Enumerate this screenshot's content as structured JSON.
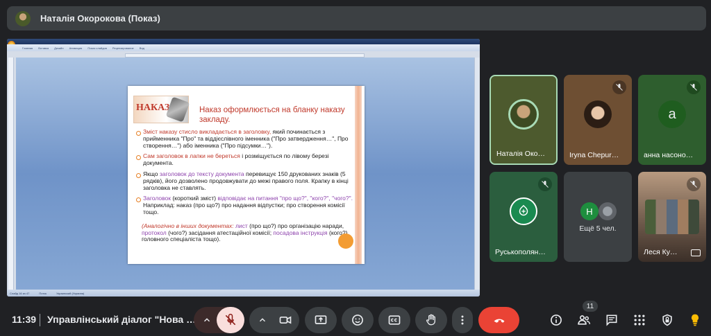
{
  "banner": {
    "presenter_title": "Наталія Окорокова (Показ)"
  },
  "shared_screen": {
    "word_ribbon_tabs": [
      "Главная",
      "Вставка",
      "Дизайн",
      "Анимация",
      "Показ слайдов",
      "Рецензирование",
      "Вид"
    ],
    "word_status_items": [
      "Слайд 16 из 47",
      "Поток",
      "Украинский (Украина)"
    ],
    "slide": {
      "logo_word": "НАКАЗ",
      "heading": "Наказ оформлюється на бланку наказу закладу.",
      "bullets": [
        {
          "red": "Зміст наказу стисло викладається в заголовку,",
          "rest": " який починається з прийменника \"Про\" та віддієслівного іменника (\"Про затвердження…\", Про створення…\") або іменника (\"Про підсумки…\")."
        },
        {
          "red": "Сам заголовок в лапки не береться",
          "rest": " і розміщується по лівому березі документа."
        },
        {
          "before": "Якщо ",
          "purple": "заголовок до тексту документа",
          "rest": " перевищує 150 друкованих знаків (5 рядків), його дозволено продовжувати до межі правого поля. Крапку в кінці заголовка не ставлять."
        },
        {
          "purple": "Заголовок",
          "mid": " (короткий зміст) ",
          "purple2": "відповідає на питання \"про що?\", \"кого?\", \"чого?\".",
          "rest": " Наприклад: наказ (про що?) про надання відпустки; про створення комісії тощо."
        }
      ],
      "italic_red": "(Аналогічно в інших документах:",
      "italic_list": " лист",
      "italic_rest1": " (про що?) про організацію наради, ",
      "italic_protocol": "протокол",
      "italic_rest2": " (чого?) засідання атестаційної комісії; ",
      "italic_instr": "посадова інструкція",
      "italic_rest3": " (кого?) головного спеціаліста тощо)."
    }
  },
  "participants": [
    {
      "name": "Наталія Око…",
      "muted": false,
      "speaking": true
    },
    {
      "name": "Iryna Chepur…",
      "muted": true
    },
    {
      "name": "анна насоно…",
      "muted": true,
      "avatar_letter": "а"
    },
    {
      "name": "Руськополян…",
      "muted": true
    },
    {
      "name": "Ещё 5 чел.",
      "avatar_letter": "Н"
    },
    {
      "name": "Леся Ку…",
      "muted": true
    }
  ],
  "bottom_bar": {
    "time": "11:39",
    "meeting_name": "Управлінський діалог \"Нова …",
    "participants_count": "11"
  },
  "colors": {
    "background": "#202124",
    "surface": "#3c4043",
    "mic_off": "#f9dedc",
    "mic_off_icon": "#8c1d18",
    "end_call": "#ea4335",
    "speaking_border": "#a8dab5"
  },
  "icons": {
    "mic": "mic-off-icon",
    "camera": "videocam-icon",
    "present": "present-screen-icon",
    "reactions": "emoji-icon",
    "captions": "closed-captions-icon",
    "hand": "raise-hand-icon",
    "more": "more-vert-icon",
    "end": "call-end-icon",
    "info": "info-icon",
    "people": "people-icon",
    "chat": "chat-icon",
    "activities": "apps-icon",
    "host": "host-controls-icon"
  }
}
